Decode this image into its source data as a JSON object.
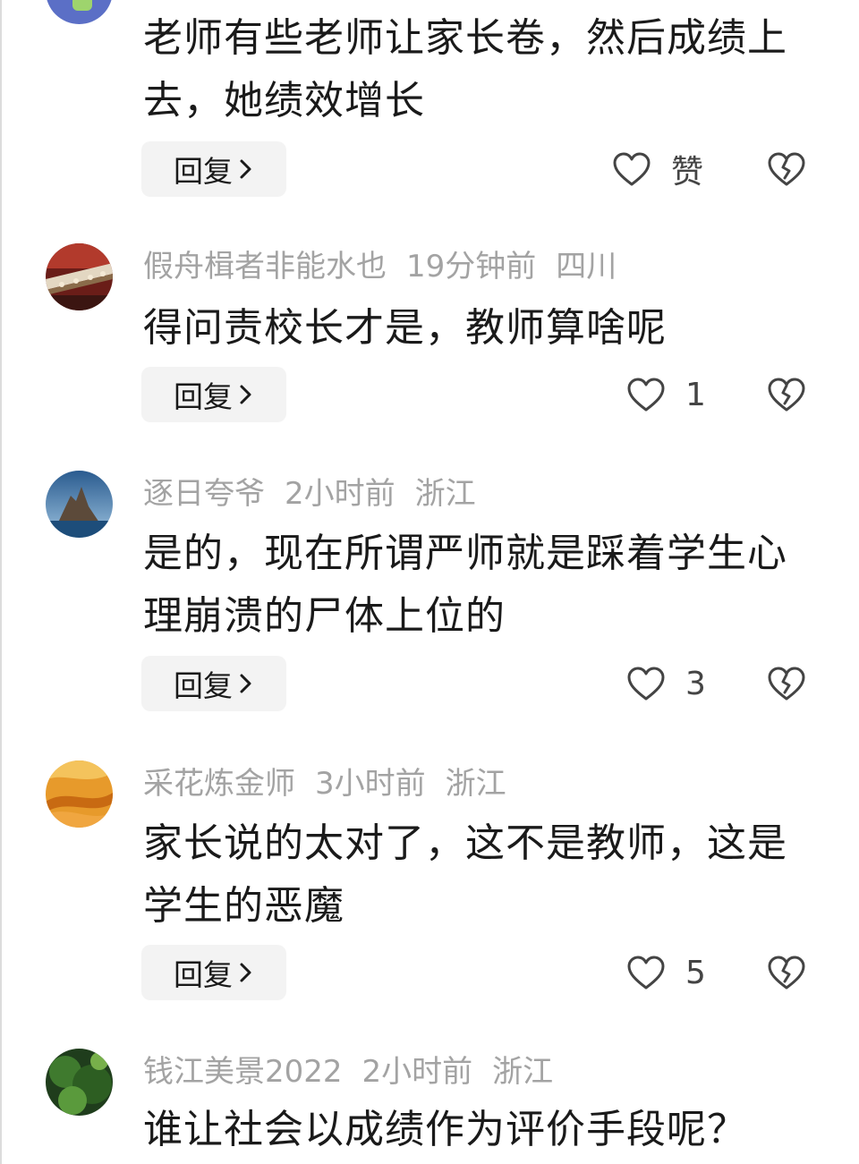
{
  "comments": [
    {
      "username": "",
      "time": "",
      "location": "",
      "text": "老师有些老师让家长卷，然后成绩上去，她绩效增长",
      "reply_label": "回复",
      "like_label": "赞",
      "avatar_icon": "avatar-partial-icon"
    },
    {
      "username": "假舟楫者非能水也",
      "time": "19分钟前",
      "location": "四川",
      "text": "得问责校长才是，教师算啥呢",
      "reply_label": "回复",
      "like_label": "1",
      "avatar_icon": "avatar-palace-roof-icon"
    },
    {
      "username": "逐日夸爷",
      "time": "2小时前",
      "location": "浙江",
      "text": "是的，现在所谓严师就是踩着学生心理崩溃的尸体上位的",
      "reply_label": "回复",
      "like_label": "3",
      "avatar_icon": "avatar-sea-rock-icon"
    },
    {
      "username": "采花炼金师",
      "time": "3小时前",
      "location": "浙江",
      "text": "家长说的太对了，这不是教师，这是学生的恶魔",
      "reply_label": "回复",
      "like_label": "5",
      "avatar_icon": "avatar-desert-dunes-icon"
    },
    {
      "username": "钱江美景2022",
      "time": "2小时前",
      "location": "浙江",
      "text": "谁让社会以成绩作为评价手段呢？",
      "reply_label": "",
      "like_label": "",
      "avatar_icon": "avatar-green-landscape-icon"
    }
  ],
  "icons": {
    "like": "heart-outline-icon",
    "dislike": "broken-heart-icon",
    "chevron": "chevron-right-icon"
  },
  "colors": {
    "meta_text": "#a3a3a3",
    "body_text": "#1a1a1a",
    "reply_bg": "#f3f3f3"
  }
}
